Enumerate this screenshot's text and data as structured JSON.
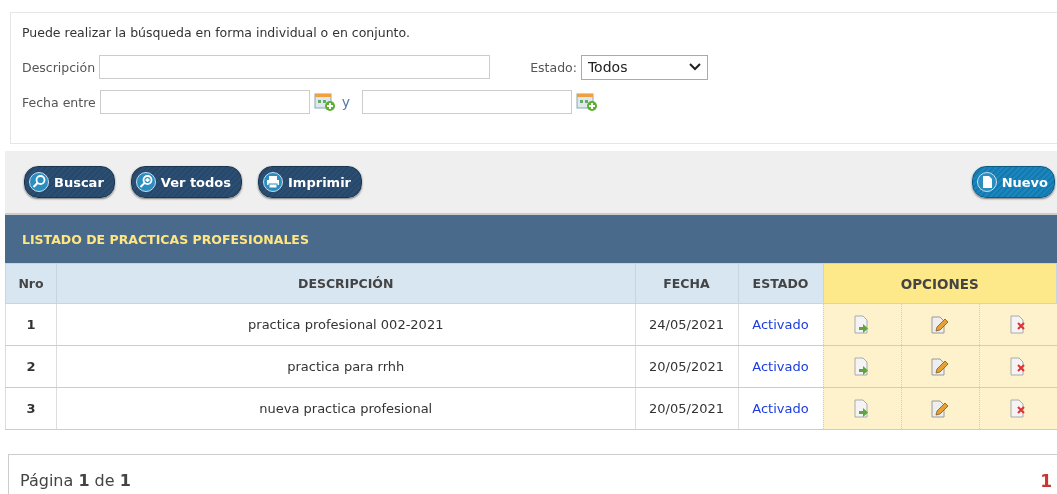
{
  "search": {
    "hint": "Puede realizar la búsqueda en forma individual o en conjunto.",
    "description_label": "Descripción",
    "status_label": "Estado:",
    "status_value": "Todos",
    "date_label": "Fecha entre",
    "date_joiner": "y"
  },
  "toolbar": [
    {
      "label": "Buscar",
      "kind": "search"
    },
    {
      "label": "Ver todos",
      "kind": "zoom"
    },
    {
      "label": "Imprimir",
      "kind": "print"
    }
  ],
  "new_button": {
    "label": "Nuevo"
  },
  "table": {
    "title": "LISTADO DE PRACTICAS PROFESIONALES",
    "columns": [
      "Nro",
      "DESCRIPCIÓN",
      "FECHA",
      "ESTADO",
      "OPCIONES"
    ],
    "rows": [
      {
        "nro": "1",
        "description": "practica profesional 002-2021",
        "date": "24/05/2021",
        "status": "Activado"
      },
      {
        "nro": "2",
        "description": "practica para rrhh",
        "date": "20/05/2021",
        "status": "Activado"
      },
      {
        "nro": "3",
        "description": "nueva practica profesional",
        "date": "20/05/2021",
        "status": "Activado"
      }
    ]
  },
  "pagination": {
    "summary": "Página **1** de **1**",
    "pages": [
      "1"
    ]
  }
}
